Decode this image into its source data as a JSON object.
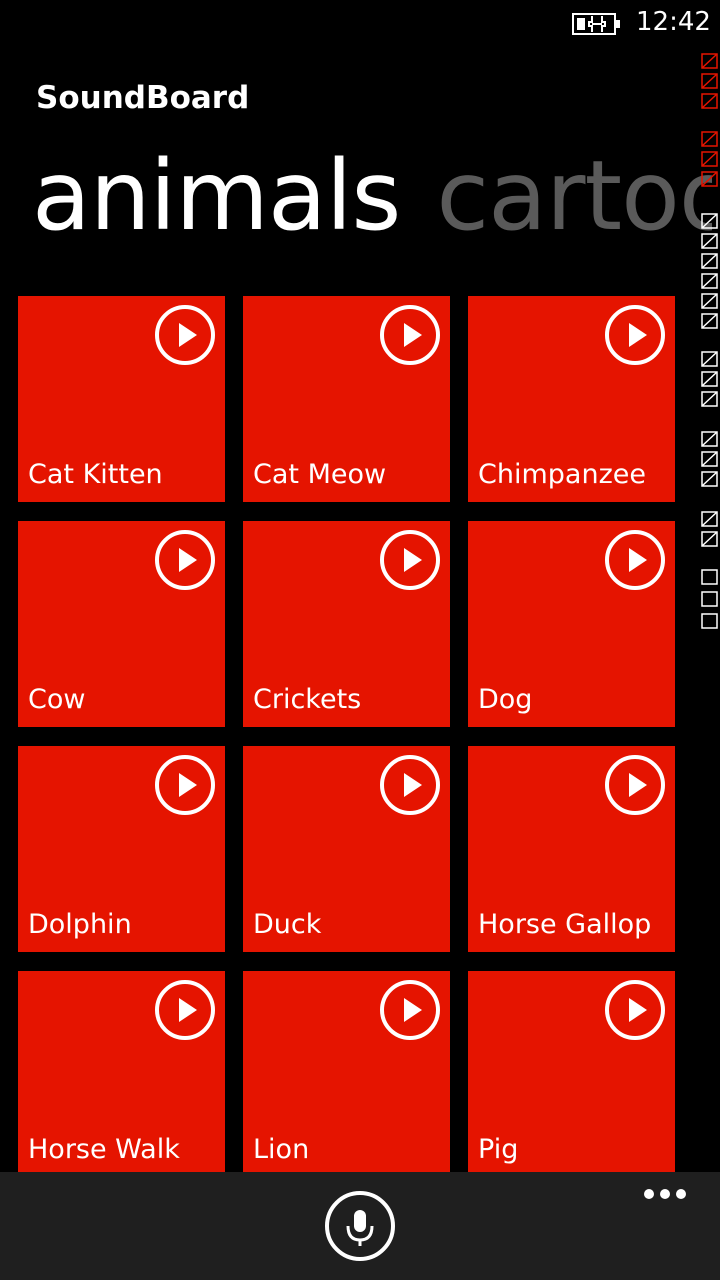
{
  "status": {
    "time": "12:42",
    "battery_icon": "battery-charging-icon"
  },
  "app": {
    "title": "SoundBoard"
  },
  "pivot": {
    "active": "animals",
    "next": "cartoo"
  },
  "tiles": [
    {
      "label": "Cat Kitten"
    },
    {
      "label": "Cat Meow"
    },
    {
      "label": "Chimpanzee"
    },
    {
      "label": "Cow"
    },
    {
      "label": "Crickets"
    },
    {
      "label": "Dog"
    },
    {
      "label": "Dolphin"
    },
    {
      "label": "Duck"
    },
    {
      "label": "Horse Gallop"
    },
    {
      "label": "Horse Walk"
    },
    {
      "label": "Lion"
    },
    {
      "label": "Pig"
    }
  ],
  "appbar": {
    "mic_icon": "microphone-icon",
    "more_icon": "ellipsis-icon"
  },
  "colors": {
    "accent": "#e51400",
    "background": "#000000",
    "appbar": "#1f1f1f",
    "inactive_pivot": "#5a5a5a"
  }
}
